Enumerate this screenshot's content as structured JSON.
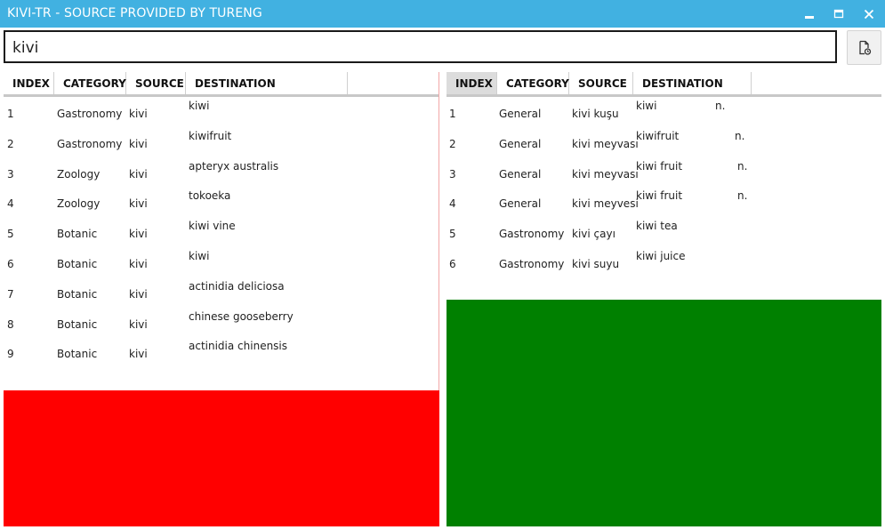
{
  "window": {
    "title": "KIVI-TR - SOURCE PROVIDED BY TURENG"
  },
  "search": {
    "value": "kivi"
  },
  "left_table": {
    "headers": [
      "INDEX",
      "CATEGORY",
      "SOURCE",
      "DESTINATION"
    ],
    "rows": [
      {
        "index": "1",
        "category": "Gastronomy",
        "source": "kivi",
        "destination": "kiwi"
      },
      {
        "index": "2",
        "category": "Gastronomy",
        "source": "kivi",
        "destination": "kiwifruit"
      },
      {
        "index": "3",
        "category": "Zoology",
        "source": "kivi",
        "destination": "apteryx australis"
      },
      {
        "index": "4",
        "category": "Zoology",
        "source": "kivi",
        "destination": "tokoeka"
      },
      {
        "index": "5",
        "category": "Botanic",
        "source": "kivi",
        "destination": "kiwi vine"
      },
      {
        "index": "6",
        "category": "Botanic",
        "source": "kivi",
        "destination": "kiwi"
      },
      {
        "index": "7",
        "category": "Botanic",
        "source": "kivi",
        "destination": "actinidia deliciosa"
      },
      {
        "index": "8",
        "category": "Botanic",
        "source": "kivi",
        "destination": "chinese gooseberry"
      },
      {
        "index": "9",
        "category": "Botanic",
        "source": "kivi",
        "destination": "actinidia chinensis"
      }
    ]
  },
  "right_table": {
    "headers": [
      "INDEX",
      "CATEGORY",
      "SOURCE",
      "DESTINATION"
    ],
    "active_header": "INDEX",
    "rows": [
      {
        "index": "1",
        "category": "General",
        "source": "kivi kuşu",
        "destination": "kiwi",
        "type": "n."
      },
      {
        "index": "2",
        "category": "General",
        "source": "kivi meyvası",
        "destination": "kiwifruit",
        "type": "n."
      },
      {
        "index": "3",
        "category": "General",
        "source": "kivi meyvası",
        "destination": "kiwi fruit",
        "type": "n."
      },
      {
        "index": "4",
        "category": "General",
        "source": "kivi meyvesi",
        "destination": "kiwi fruit",
        "type": "n."
      },
      {
        "index": "5",
        "category": "Gastronomy",
        "source": "kivi çayı",
        "destination": "kiwi tea",
        "type": ""
      },
      {
        "index": "6",
        "category": "Gastronomy",
        "source": "kivi suyu",
        "destination": "kiwi juice",
        "type": ""
      }
    ]
  },
  "colors": {
    "titlebar": "#41b1e1",
    "left_block": "#ff0000",
    "right_block": "#008000"
  },
  "icons": {
    "minimize": "minimize-icon",
    "maximize": "maximize-icon",
    "close": "close-icon",
    "export": "document-export-icon"
  }
}
